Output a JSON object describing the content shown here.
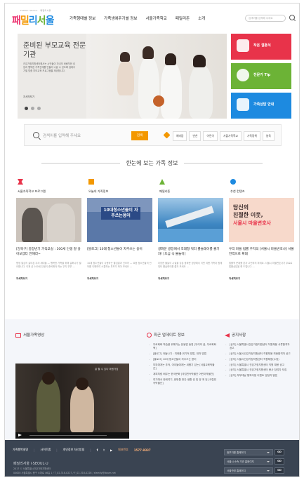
{
  "header": {
    "logo_tagline": "FAMILY SEOUL · 패밀리서울",
    "logo_parts": [
      "패",
      "밀",
      "리",
      "서",
      "울"
    ],
    "nav": [
      "가족행태별 정보",
      "가족생애주기별 정보",
      "서울가족학교",
      "패밀리존",
      "소개"
    ],
    "search_placeholder": "검색어를 입력해 주세요"
  },
  "hero": {
    "title": "준비된 부모교육 전문기관",
    "desc": "건강가정지원센터에서는 시민들이 자녀의 바람직한 성장과 행복한 가족관계를 만들어 나갈 수 있도록 생애주기별 맞춤 부모교육 프로그램을 제공합니다.",
    "more": "자세히보기"
  },
  "quick_links": [
    {
      "label": "작은 결혼식",
      "color": "#e8334a",
      "icon": "wedding-icon"
    },
    {
      "label": "전문가 Tip",
      "color": "#6cb336",
      "icon": "tip-icon"
    },
    {
      "label": "가족상담 안내",
      "color": "#1d8ae0",
      "icon": "chat-icon"
    }
  ],
  "search": {
    "placeholder": "검색어를 입력해 주세요",
    "button": "검색",
    "tags": [
      "예비맘",
      "반찬",
      "어린이",
      "서울가족학교",
      "가족정책",
      "봉육"
    ]
  },
  "section_title": "한눈에 보는 가족 정보",
  "columns": [
    {
      "title": "서울가족학교 프로그램",
      "marker_color": "#e8334a",
      "img_color": "#c8c2bb",
      "headline": "[강북구] 중장년기 가족교실 : 100세 인생 잘 살아보겠다 전해라~",
      "body": "평생 열심히 살아온 우리 세대들 — 행복한 가족을 위해 살펴나가 필요합니다. 이제 곧 100세 인생이 준비해야 하는 우리 부부 ...",
      "more": "자세히보기"
    },
    {
      "title": "오늘의 가족정보",
      "marker_color": "#f39800",
      "img_color": "#4f6ea0",
      "headline": "[블로그] 10대 청소년들이 자주쓰는 용어",
      "body": "10대 청소년들이 사용하는 줄임말과 신조어 — 요즘 청소년들의 언어를 이해하여 소통하는 부모가 되어 보세요 ...",
      "more": "자세히보기",
      "img_title": "10대청소년들이 자주쓰는용어"
    },
    {
      "title": "패밀리존",
      "marker_color": "#6cb336",
      "img_color": "#4a8fc4",
      "headline": "광화문 광장에서 조대형 워터 롤슬레이를 즐기자! [도심 속 물놀이]",
      "body": "다양한 물놀이 시설을 갖춘 광화문 광장에서 이번 여름 가족과 함께 워터 롤슬레이를 즐겨 보세요 ...",
      "more": "자세히보기"
    },
    {
      "title": "추천 컨텐츠",
      "marker_color": "#1d8ae0",
      "img_color": "#f2c9b8",
      "headline": "우리 마을 법률 주치의 [서울시 마을변호사] 서울 전역으로 확대",
      "body": "법률적 문제를 혼자 고민하지 마세요. 서울시 마을변호사가 무료로 법률상담을 해 드립니다 ...",
      "more": "자세히보기",
      "img_line1": "당신의",
      "img_line2": "친절한 이웃,",
      "img_line3": "서울시 마을변호사"
    }
  ],
  "video": {
    "title": "서울가족영상",
    "caption": "잘 할 수 있다 마음가짐"
  },
  "updates": {
    "title": "최근 업데이트 정보",
    "items": [
      "무료회화 학습을 위해가는 운동법 동영 [우리의 꿈, 무료회화책]",
      "[블로그] 아들나기 : 미래를 위기적 방법, 대처 방법",
      "[블로그] 10대 청소년들이 자주쓰는 용어",
      "부부에게는 추억, 아이들에게는 새롭기 있는 [서울교육박물관]",
      "계피처럼 배우는 한국문화 [국립민속박물관 어린이박물관]",
      "여기에서 한테여기, 한번쯤 반간 생활 성 및 양 게 된 [국립민속박물관]"
    ]
  },
  "notices": {
    "title": "공지사항",
    "items": [
      "[공지] 서울특별시건강가정지원센터 직원채용 서류합격자 공고",
      "[공지] 서울시건강가정지원센터 직원채용 최종합격자 공고",
      "[공지] 서울시건강가정지원센터 직원채용(수정)",
      "[공지] 서울특별시 건강가정지원센터 직원 채용 공고",
      "[공지] 서울특별시 건강가정지원센터 봉사 참여자 모집",
      "[공지] 부부데날 행복이용 이벤트 당첨자 발표"
    ]
  },
  "footer": {
    "links": [
      "가족행복설명",
      "사이트맵",
      "개인정보 처리방침"
    ],
    "social": [
      "f",
      "t",
      "▶"
    ],
    "tel_label": "대표번호",
    "tel": "1577-9337",
    "logo": "패밀리서울  I·SEOUL·U",
    "copyright": "2017 ⓒ 서울특별시건강가정지원센터",
    "address": "04628 서울특별시 중구 소파로 46길 1 / T_02-318-0227 / F_02-318-0228 / sfamily@daum.net",
    "selects": [
      "정부지원 홈페이지",
      "서울시 소속 기관 홈페이지",
      "서울관련 홈페이지"
    ],
    "go": "GO"
  }
}
